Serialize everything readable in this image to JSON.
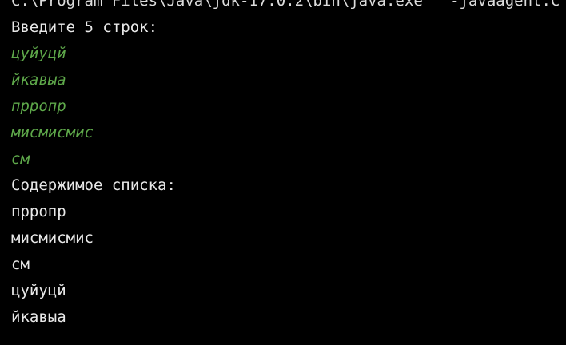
{
  "console": {
    "command_line": "C:\\Program Files\\Java\\jdk-17.0.2\\bin\\java.exe\" \"-javaagent:C",
    "prompt": "Введите 5 строк:",
    "inputs": [
      "цуйуцй",
      "йкавыа",
      "прропр",
      "мисмисмис",
      "см"
    ],
    "list_header": "Содержимое списка:",
    "outputs": [
      "прропр",
      "мисмисмис",
      "см",
      "цуйуцй",
      "йкавыа"
    ]
  },
  "colors": {
    "background": "#000000",
    "text": "#e8e8e8",
    "user_input": "#5ea84a"
  }
}
